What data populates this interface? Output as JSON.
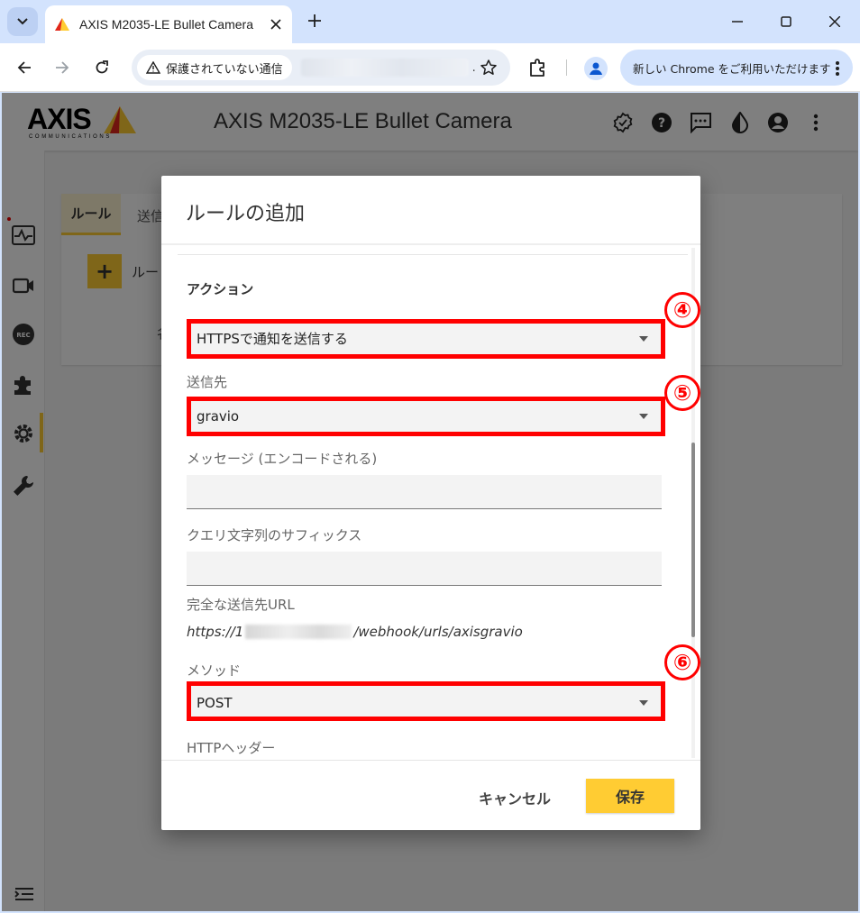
{
  "browser": {
    "tab_title": "AXIS M2035-LE Bullet Camera",
    "security_label": "保護されていない通信",
    "url_trailing": ".",
    "chrome_promo": "新しい Chrome をご利用いただけます"
  },
  "app": {
    "brand": "AXIS",
    "brand_sub": "COMMUNICATIONS",
    "title": "AXIS M2035-LE Bullet Camera",
    "colors": {
      "accent": "#ffcc33",
      "annotation": "#ff0000"
    }
  },
  "side_nav": {
    "items": [
      "status-icon",
      "video-icon",
      "rec-icon",
      "apps-icon",
      "settings-icon",
      "maintenance-icon"
    ],
    "rec_label": "REC"
  },
  "content": {
    "tabs": [
      "ルール",
      "送信"
    ],
    "add_rule_label": "ルー",
    "name_partial": "名"
  },
  "dialog": {
    "title": "ルールの追加",
    "section_title": "アクション",
    "action_select": "HTTPSで通知を送信する",
    "recipient_label": "送信先",
    "recipient_select": "gravio",
    "message_label": "メッセージ (エンコードされる)",
    "message_value": "",
    "query_label": "クエリ文字列のサフィックス",
    "query_value": "",
    "full_url_label": "完全な送信先URL",
    "full_url_prefix": "https://1",
    "full_url_suffix": "/webhook/urls/axisgravio",
    "method_label": "メソッド",
    "method_select": "POST",
    "http_header_label": "HTTPヘッダー",
    "cancel_label": "キャンセル",
    "save_label": "保存",
    "annotations": [
      "④",
      "⑤",
      "⑥"
    ]
  }
}
